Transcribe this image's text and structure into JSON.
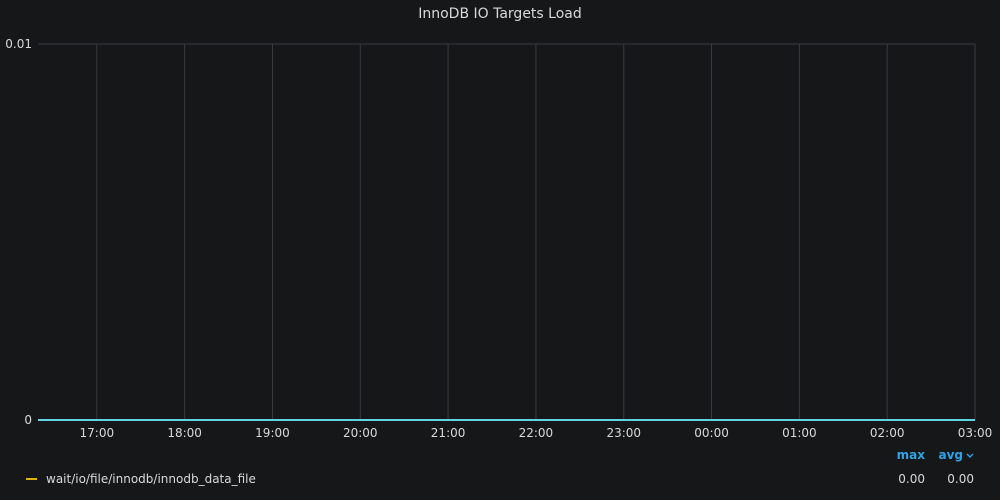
{
  "panel": {
    "title": "InnoDB IO Targets Load"
  },
  "colors": {
    "background": "#161719",
    "grid": "#3a3b3e",
    "axis_text": "#d8d9da",
    "series_line": "#5ed4e6",
    "legend_swatch": "#e0b400",
    "legend_header": "#33a2e5"
  },
  "chart_data": {
    "type": "line",
    "title": "InnoDB IO Targets Load",
    "xlabel": "",
    "ylabel": "",
    "ylim": [
      0,
      0.01
    ],
    "y_ticks": [
      "0",
      "0.01"
    ],
    "x_ticks": [
      "17:00",
      "18:00",
      "19:00",
      "20:00",
      "21:00",
      "22:00",
      "23:00",
      "00:00",
      "01:00",
      "02:00",
      "03:00"
    ],
    "x_range_hours": [
      16.33,
      27.0
    ],
    "grid": true,
    "legend_placement": "bottom",
    "series": [
      {
        "name": "wait/io/file/innodb/innodb_data_file",
        "color": "#5ed4e6",
        "x_hours": [
          16.33,
          17.0,
          18.0,
          19.0,
          20.0,
          21.0,
          22.0,
          23.0,
          24.0,
          25.0,
          26.0,
          27.0
        ],
        "values": [
          0,
          0,
          0,
          0,
          0,
          0,
          0,
          0,
          0,
          0,
          0,
          0
        ]
      }
    ]
  },
  "legend": {
    "columns": [
      {
        "label": "max",
        "sort_icon": "chevron-down-icon",
        "sorted": false
      },
      {
        "label": "avg",
        "sort_icon": "chevron-down-icon",
        "sorted": true
      }
    ],
    "rows": [
      {
        "name": "wait/io/file/innodb/innodb_data_file",
        "max": "0.00",
        "avg": "0.00"
      }
    ]
  }
}
